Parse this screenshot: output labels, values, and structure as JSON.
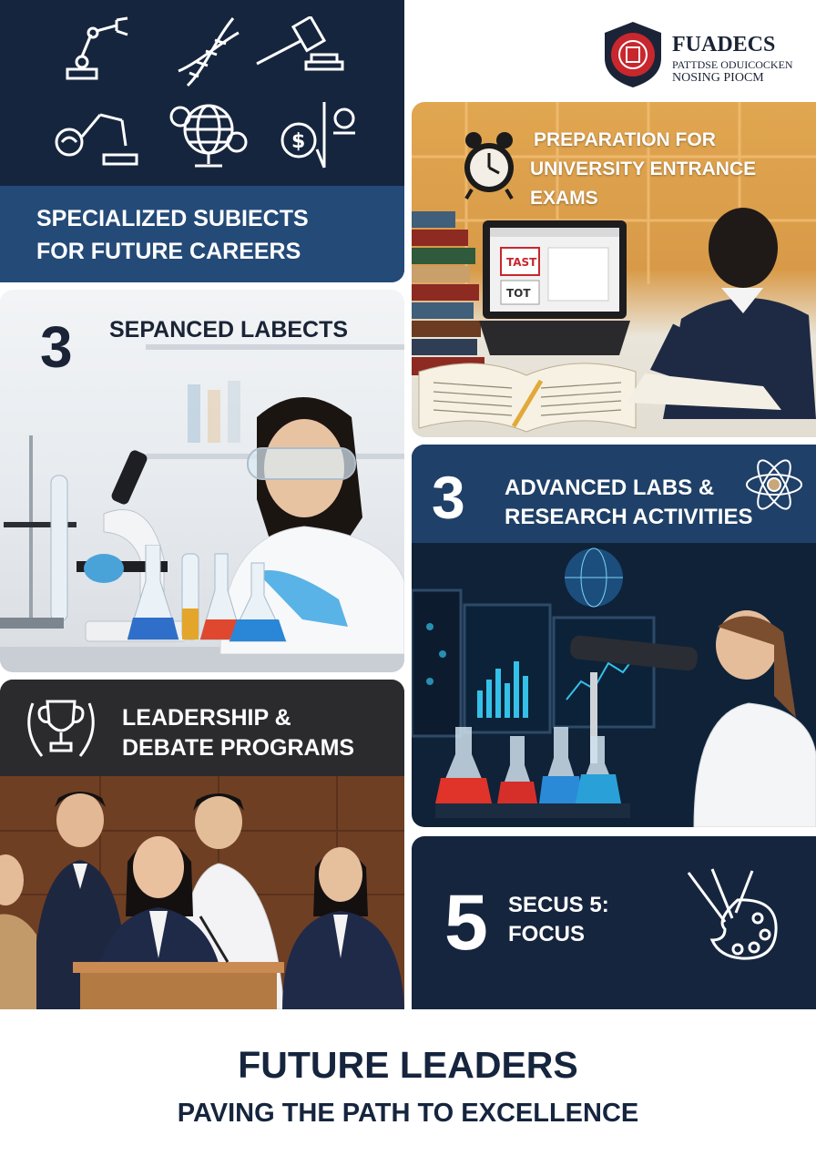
{
  "logo": {
    "brand": "FUADECS",
    "subtitle_line1": "PATTDSE ODUICOCKEN",
    "subtitle_line2": "NOSING PIOCM",
    "emblem_icon": "shield-emblem-icon"
  },
  "careers": {
    "title_line1": "SPECIALIZED SUBIECTS",
    "title_line2": "FOR FUTURE CAREERS",
    "icons": [
      "robot-arm-icon",
      "dna-icon",
      "gavel-icon",
      "lab-robot-icon",
      "globe-currency-icon",
      "dollar-compass-icon"
    ]
  },
  "lab": {
    "number": "3",
    "label": "SEPANCED LABECTS"
  },
  "exam": {
    "title_line1": "PREPARATION FOR",
    "title_line2": "UNIVERSITY ENTRANCE EXAMS",
    "screen_text_1": "TAST",
    "screen_text_2": "TOT"
  },
  "advanced": {
    "number": "3",
    "title_line1": "ADVANCED LABS &",
    "title_line2": "RESEARCH ACTIVITIES"
  },
  "leadership": {
    "title_line1": "LEADERSHIP &",
    "title_line2": "DEBATE PROGRAMS"
  },
  "focus": {
    "number": "5",
    "title_line1": "SECUS 5:",
    "title_line2": "FOCUS"
  },
  "footer": {
    "title": "FUTURE LEADERS",
    "subtitle": "PAVING THE PATH TO EXCELLENCE"
  },
  "colors": {
    "navy": "#16253e",
    "blue_band": "#244a78",
    "advanced_band": "#1f4068",
    "leadership_band": "#2b2b2e",
    "logo_red": "#c8272d"
  }
}
